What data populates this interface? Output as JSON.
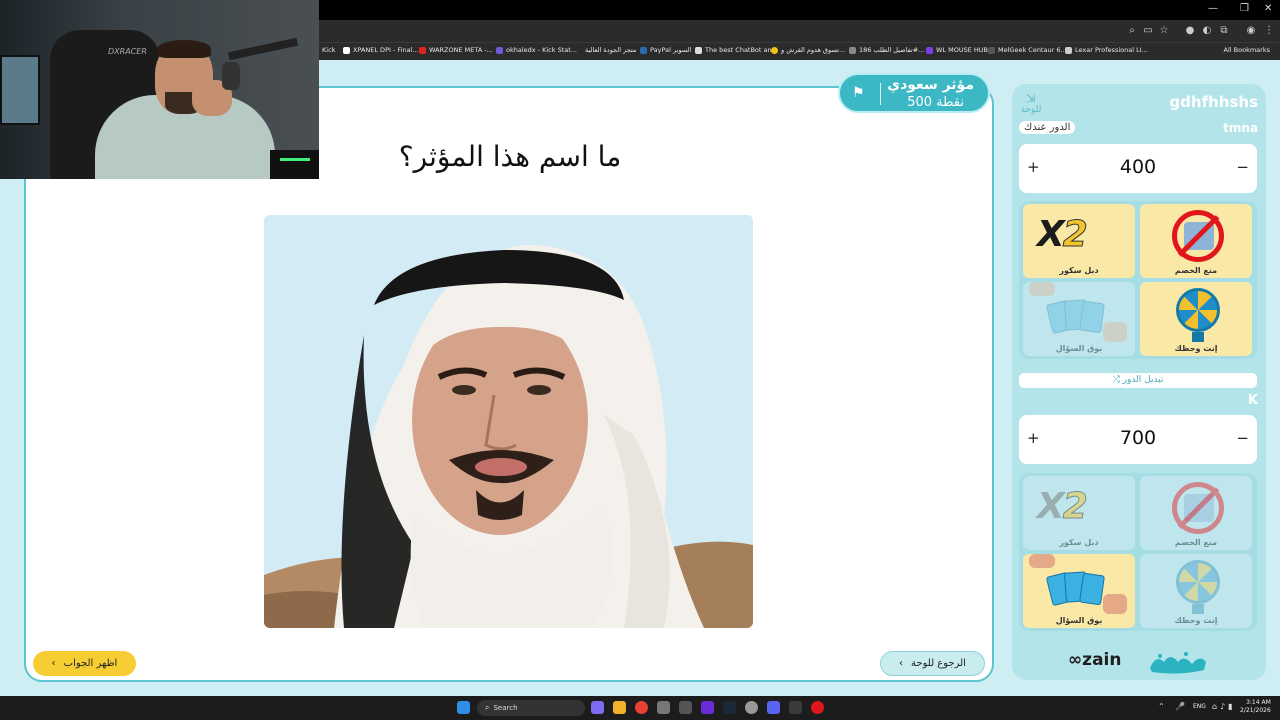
{
  "browser": {
    "bookmarks": [
      {
        "label": "Kick",
        "color": "#53fc18"
      },
      {
        "label": "XPANEL DPI - Final...",
        "color": "#ffffff"
      },
      {
        "label": "WARZONE META -...",
        "color": "#e02424"
      },
      {
        "label": "okhaledx - Kick Stat...",
        "color": "#6b5bd6"
      },
      {
        "label": "متجر الجودة العالية",
        "color": "#444444"
      },
      {
        "label": "PayPal السوبر",
        "color": "#2b6cb0"
      },
      {
        "label": "The best ChatBot an...",
        "color": "#dddddd"
      },
      {
        "label": "تسوق هدوم القرش و...",
        "color": "#f1c40f"
      },
      {
        "label": "تفاصيل الطلب 186#...",
        "color": "#888888"
      },
      {
        "label": "WL MOUSE HUB",
        "color": "#7b3fe4"
      },
      {
        "label": "MelGeek Centaur 6...",
        "color": "#555555"
      },
      {
        "label": "Lexar Professional LI...",
        "color": "#cccccc"
      }
    ],
    "all_bookmarks": "All Bookmarks"
  },
  "webcam": {
    "chair_brand": "DXRACER"
  },
  "question": {
    "category": "مؤثر سعودي",
    "points": "500 نقطة",
    "text": "ما اسم هذا المؤثر؟",
    "show_answer": "اظهر الجواب",
    "back_to_board": "الرجوع للوحة"
  },
  "sidebar": {
    "board_link": "للوحة",
    "team1": {
      "name": "gdhfhhshs",
      "subname": "tmna",
      "turn_badge": "الدور عندك",
      "score": "400",
      "plus": "+",
      "minus": "−",
      "tools": [
        {
          "label": "دبل سكور",
          "icon": "x2-icon",
          "active": true
        },
        {
          "label": "منع الخصم",
          "icon": "block-opponent-icon",
          "active": true
        },
        {
          "label": "بوق السؤال",
          "icon": "cards-icon",
          "active": false
        },
        {
          "label": "إنت وحظك",
          "icon": "wheel-icon",
          "active": true
        }
      ]
    },
    "switch_turn": "⤮ تبديل الدور",
    "team2": {
      "name": "K",
      "score": "700",
      "plus": "+",
      "minus": "−",
      "tools": [
        {
          "label": "دبل سكور",
          "icon": "x2-icon",
          "active": false
        },
        {
          "label": "منع الخصم",
          "icon": "block-opponent-icon",
          "active": false
        },
        {
          "label": "بوق السؤال",
          "icon": "cards-icon",
          "active": true
        },
        {
          "label": "إنت وحظك",
          "icon": "wheel-icon",
          "active": false
        }
      ]
    },
    "sponsor": "zain"
  },
  "taskbar": {
    "search": "Search",
    "lang": "ENG",
    "time": "3:14 AM",
    "date": "2/21/2026"
  }
}
